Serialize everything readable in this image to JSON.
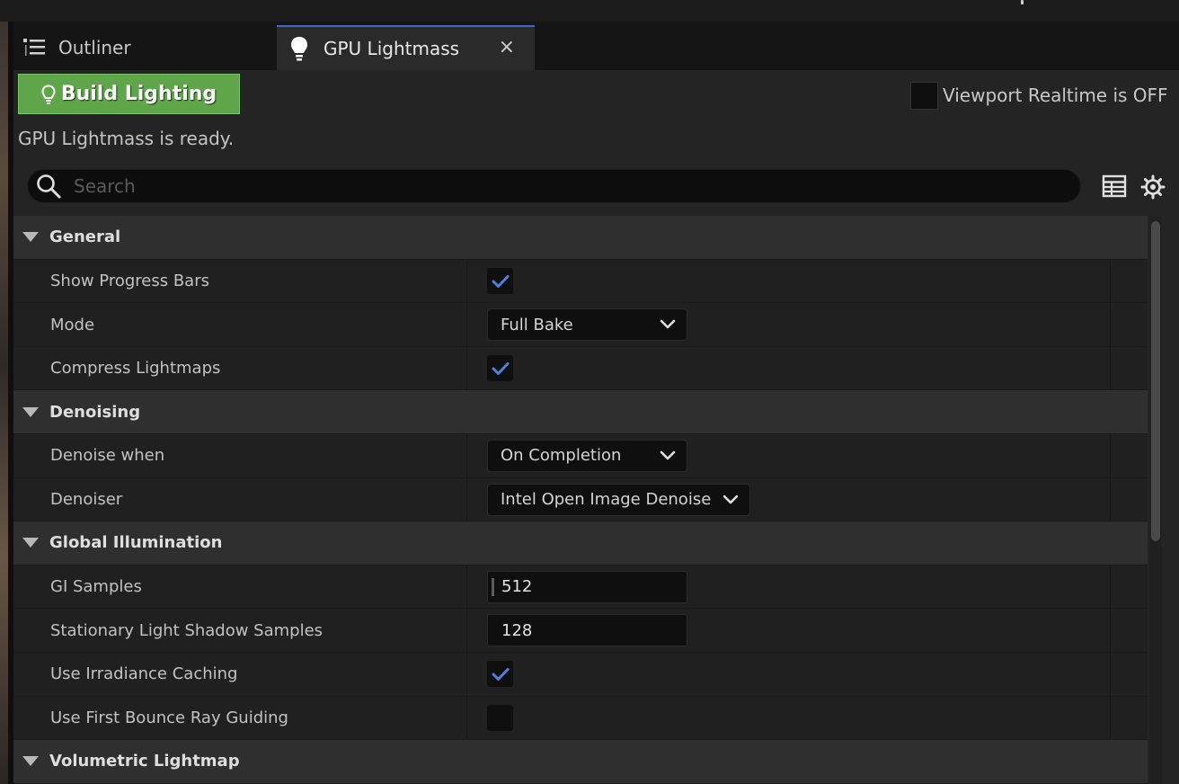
{
  "tabs": [
    {
      "label": "Outliner",
      "icon": "outliner-icon"
    },
    {
      "label": "GPU Lightmass",
      "icon": "lightbulb-icon",
      "close": "×"
    }
  ],
  "toolbar": {
    "build_label": "Build Lighting",
    "realtime_label": "Viewport Realtime is OFF",
    "realtime_checked": false,
    "status": "GPU Lightmass is ready."
  },
  "search": {
    "placeholder": "Search"
  },
  "colors": {
    "accent": "#3a6cc8",
    "build_button": "#5ea649",
    "check": "#4a82e0"
  },
  "sections": [
    {
      "title": "General",
      "props": [
        {
          "name": "Show Progress Bars",
          "kind": "checkbox",
          "checked": true
        },
        {
          "name": "Mode",
          "kind": "combo",
          "value": "Full Bake"
        },
        {
          "name": "Compress Lightmaps",
          "kind": "checkbox",
          "checked": true
        }
      ]
    },
    {
      "title": "Denoising",
      "props": [
        {
          "name": "Denoise when",
          "kind": "combo",
          "value": "On Completion"
        },
        {
          "name": "Denoiser",
          "kind": "combo",
          "value": "Intel Open Image Denoise"
        }
      ]
    },
    {
      "title": "Global Illumination",
      "props": [
        {
          "name": "GI Samples",
          "kind": "number",
          "value": "512"
        },
        {
          "name": "Stationary Light Shadow Samples",
          "kind": "number",
          "value": "128"
        },
        {
          "name": "Use Irradiance Caching",
          "kind": "checkbox",
          "checked": true
        },
        {
          "name": "Use First Bounce Ray Guiding",
          "kind": "checkbox",
          "checked": false
        }
      ]
    },
    {
      "title": "Volumetric Lightmap",
      "props": []
    }
  ]
}
